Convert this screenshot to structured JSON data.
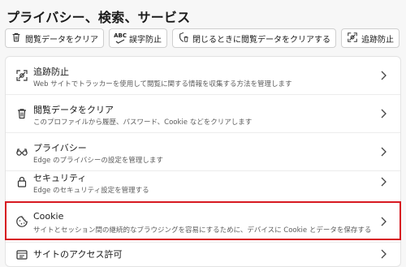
{
  "page": {
    "title": "プライバシー、検索、サービス"
  },
  "toolbar": {
    "buttons": [
      {
        "label": "閲覧データをクリア",
        "icon": "trash-icon"
      },
      {
        "label": "誤字防止",
        "icon": "spellcheck-icon"
      },
      {
        "label": "閉じるときに閲覧データをクリアする",
        "icon": "shield-trash-icon"
      },
      {
        "label": "追跡防止",
        "icon": "tracking-prevention-icon"
      }
    ],
    "spell_icon_text": "ABC"
  },
  "settings": {
    "items": [
      {
        "title": "追跡防止",
        "description": "Web サイトでトラッカーを使用して閲覧に関する情報を収集する方法を管理します",
        "icon": "tracking-prevention-icon"
      },
      {
        "title": "閲覧データをクリア",
        "description": "このプロファイルから履歴、パスワード、Cookie などをクリアします",
        "icon": "trash-icon"
      },
      {
        "title": "プライバシー",
        "description": "Edge のプライバシーの設定を管理します",
        "icon": "glasses-icon"
      },
      {
        "title": "セキュリティ",
        "description": "Edge のセキュリティ設定を管理する",
        "icon": "lock-icon"
      },
      {
        "title": "Cookie",
        "description": "サイトとセッション間の継続的なブラウジングを容易にするために、デバイスに Cookie とデータを保存する",
        "icon": "cookie-icon",
        "highlighted": true
      },
      {
        "title": "サイトのアクセス許可",
        "description": "",
        "icon": "site-permissions-icon"
      }
    ]
  },
  "colors": {
    "background": "#f7f7f7",
    "card": "#ffffff",
    "highlight": "#d71921"
  }
}
